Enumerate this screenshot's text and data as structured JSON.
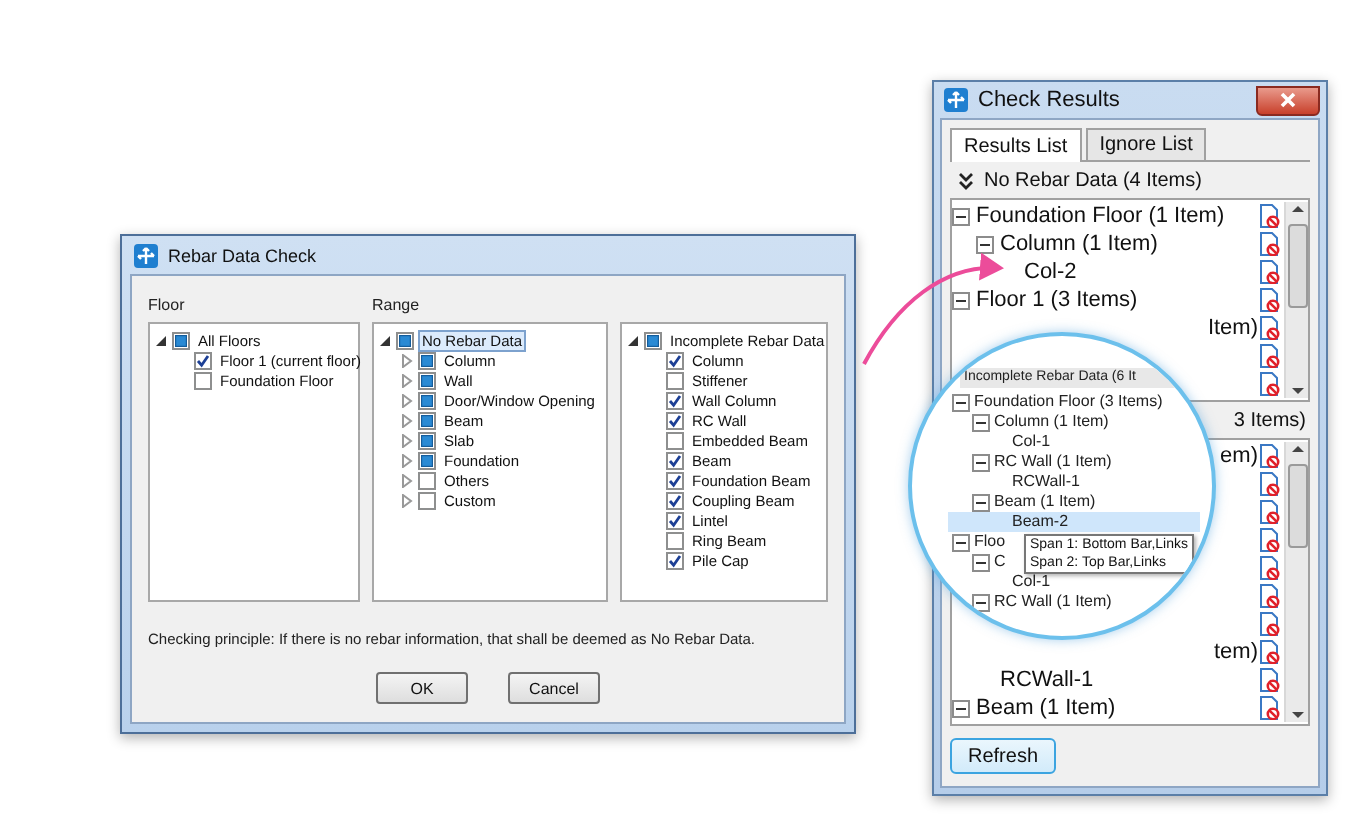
{
  "dialog": {
    "title": "Rebar Data Check",
    "floor": {
      "label": "Floor",
      "tree": [
        {
          "label": "All Floors",
          "checked": false,
          "partial": true,
          "expanded": true,
          "children": [
            {
              "label": "Floor 1 (current floor)",
              "checked": true,
              "partial": false
            },
            {
              "label": "Foundation Floor",
              "checked": false,
              "partial": false
            }
          ]
        }
      ]
    },
    "range": {
      "label": "Range",
      "trees": [
        [
          {
            "label": "No Rebar Data",
            "checked": false,
            "partial": true,
            "expanded": true,
            "selected": true,
            "children": [
              {
                "label": "Column",
                "checked": false,
                "partial": true,
                "expanded": false
              },
              {
                "label": "Wall",
                "checked": false,
                "partial": true,
                "expanded": false
              },
              {
                "label": "Door/Window Opening",
                "checked": false,
                "partial": true,
                "expanded": false
              },
              {
                "label": "Beam",
                "checked": false,
                "partial": true,
                "expanded": false
              },
              {
                "label": "Slab",
                "checked": false,
                "partial": true,
                "expanded": false
              },
              {
                "label": "Foundation",
                "checked": false,
                "partial": true,
                "expanded": false
              },
              {
                "label": "Others",
                "checked": false,
                "partial": false,
                "expanded": false
              },
              {
                "label": "Custom",
                "checked": false,
                "partial": false,
                "expanded": false
              }
            ]
          }
        ],
        [
          {
            "label": "Incomplete Rebar Data",
            "checked": false,
            "partial": true,
            "expanded": true,
            "selected": false,
            "children": [
              {
                "label": "Column",
                "checked": true,
                "partial": false
              },
              {
                "label": "Stiffener",
                "checked": false,
                "partial": false
              },
              {
                "label": "Wall Column",
                "checked": true,
                "partial": false
              },
              {
                "label": "RC Wall",
                "checked": true,
                "partial": false
              },
              {
                "label": "Embedded Beam",
                "checked": false,
                "partial": false
              },
              {
                "label": "Beam",
                "checked": true,
                "partial": false
              },
              {
                "label": "Foundation Beam",
                "checked": true,
                "partial": false
              },
              {
                "label": "Coupling Beam",
                "checked": true,
                "partial": false
              },
              {
                "label": "Lintel",
                "checked": true,
                "partial": false
              },
              {
                "label": "Ring Beam",
                "checked": false,
                "partial": false
              },
              {
                "label": "Pile Cap",
                "checked": true,
                "partial": false
              }
            ]
          }
        ]
      ]
    },
    "note": "Checking principle: If there is no rebar information, that shall be deemed as No Rebar Data.",
    "buttons": [
      "OK",
      "Cancel"
    ]
  },
  "results": {
    "title": "Check Results",
    "tabs": [
      {
        "label": "Results List",
        "selected": true
      },
      {
        "label": "Ignore List",
        "selected": false
      }
    ],
    "sections": [
      {
        "kind": "full",
        "header": "No Rebar Data (4 Items)",
        "tree": [
          {
            "label": "Foundation Floor (1 Item)",
            "expanded": true,
            "children": [
              {
                "label": "Column (1 Item)",
                "expanded": true,
                "children": [
                  {
                    "label": "Col-2"
                  }
                ]
              }
            ]
          },
          {
            "label": "Floor 1 (3 Items)",
            "expanded": true,
            "children": [
              {
                "kind": "fragment",
                "label": "Item)"
              },
              {
                "kind": "covered"
              },
              {
                "kind": "covered"
              }
            ]
          }
        ]
      },
      {
        "kind": "fragment",
        "header": "3 Items)",
        "tree": [
          {
            "kind": "fragment",
            "label": "em)"
          },
          {
            "kind": "covered"
          },
          {
            "kind": "covered"
          },
          {
            "kind": "covered"
          },
          {
            "kind": "covered"
          },
          {
            "kind": "covered"
          },
          {
            "kind": "covered"
          },
          {
            "kind": "fragment",
            "label": "tem)",
            "children": [
              {
                "label": "RCWall-1"
              }
            ]
          },
          {
            "label": "Beam (1 Item)",
            "expanded": true
          }
        ]
      }
    ],
    "button": "Refresh"
  },
  "magnifier": {
    "header": "Incomplete Rebar Data (6 It",
    "tree": [
      {
        "label": "Foundation Floor (3 Items)",
        "expanded": true,
        "selected": false,
        "children": [
          {
            "label": "Column (1 Item)",
            "expanded": true,
            "selected": false,
            "children": [
              {
                "label": "Col-1",
                "selected": false
              }
            ]
          },
          {
            "label": "RC Wall (1 Item)",
            "expanded": true,
            "selected": false,
            "children": [
              {
                "label": "RCWall-1",
                "selected": false
              }
            ]
          },
          {
            "label": "Beam (1 Item)",
            "expanded": true,
            "selected": false,
            "children": [
              {
                "label": "Beam-2",
                "selected": true
              }
            ]
          }
        ]
      },
      {
        "label": "Floo",
        "expanded": true,
        "selected": false,
        "children": [
          {
            "label": "C",
            "expanded": true,
            "selected": false,
            "children": [
              {
                "label": "Col-1",
                "selected": false
              }
            ]
          },
          {
            "label": "RC Wall (1 Item)",
            "expanded": true,
            "selected": false
          }
        ]
      }
    ],
    "tooltip": [
      "Span 1: Bottom Bar,Links",
      "Span 2: Top Bar,Links"
    ]
  }
}
